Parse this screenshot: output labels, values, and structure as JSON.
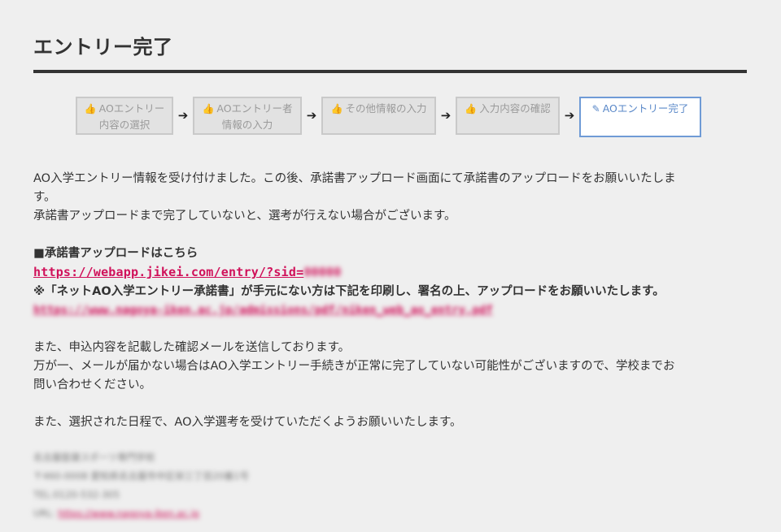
{
  "page": {
    "title": "エントリー完了"
  },
  "steps": [
    {
      "icon": "thumbs-up-icon",
      "glyph": "👍",
      "label": "AOエントリー\n内容の選択",
      "active": false
    },
    {
      "icon": "thumbs-up-icon",
      "glyph": "👍",
      "label": "AOエントリー者\n情報の入力",
      "active": false
    },
    {
      "icon": "thumbs-up-icon",
      "glyph": "👍",
      "label": "その他情報の入力",
      "active": false
    },
    {
      "icon": "thumbs-up-icon",
      "glyph": "👍",
      "label": "入力内容の確認",
      "active": false
    },
    {
      "icon": "edit-icon",
      "glyph": "✎",
      "label": "AOエントリー完了",
      "active": true
    }
  ],
  "step_arrow_glyph": "➔",
  "message": {
    "line1": "AO入学エントリー情報を受け付けました。この後、承諾書アップロード画面にて承諾書のアップロードをお願いいたしま",
    "line1b": "す。",
    "line2": "承諾書アップロードまで完了していないと、選考が行えない場合がございます。",
    "upload_heading": "■承諾書アップロードはこちら",
    "upload_link": "https://webapp.jikei.com/entry/?sid=",
    "upload_link_sid": "00000",
    "print_note": "※「ネットAO入学エントリー承諾書」が手元にない方は下記を印刷し、署名の上、アップロードをお願いいたします。",
    "pdf_link": "https://www.nagoya-iken.ac.jp/admissions/pdf/niken_web_ao_entry.pdf",
    "mail_line1": "また、申込内容を記載した確認メールを送信しております。",
    "mail_line2": "万が一、メールが届かない場合はAO入学エントリー手続きが正常に完了していない可能性がございますので、学校までお",
    "mail_line2b": "問い合わせください。",
    "schedule_line": "また、選択された日程で、AO入学選考を受けていただくようお願いいたします。"
  },
  "footer": {
    "school": "名古屋医健スポーツ専門学校",
    "address": "〒460-0008 愛知県名古屋市中区栄三丁目20番1号",
    "tel": "TEL:0120-532-305",
    "url_label": "URL:",
    "url": "https://www.nagoya-iken.ac.jp"
  },
  "colors": {
    "background": "#efefef",
    "link": "#d0115a",
    "active_step": "#5a88c8",
    "inactive_step_bg": "#e2e2e2"
  }
}
